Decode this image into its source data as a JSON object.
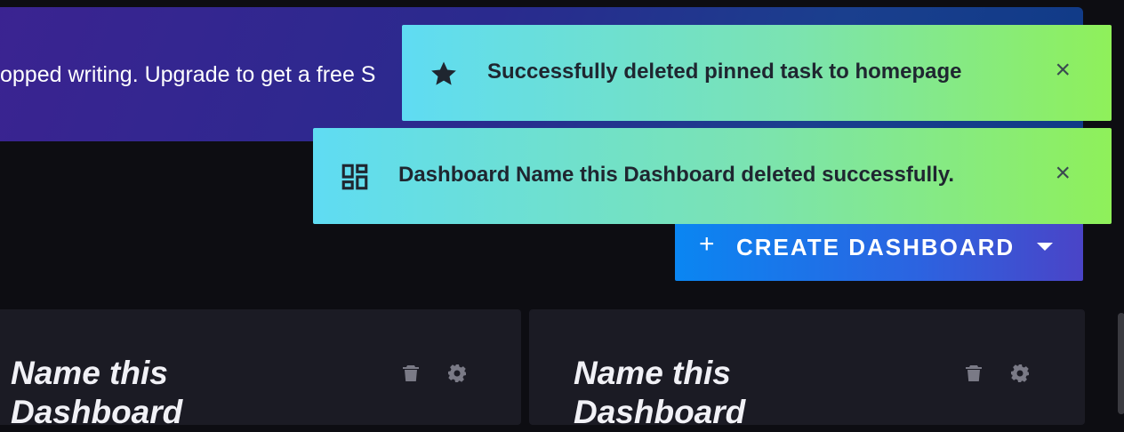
{
  "banner": {
    "text": "opped writing. Upgrade to get a free S"
  },
  "notifications": [
    {
      "icon": "star-icon",
      "message": "Successfully deleted pinned task to homepage",
      "close": "×"
    },
    {
      "icon": "dashboard-icon",
      "message": "Dashboard Name this Dashboard deleted successfully.",
      "close": "×"
    }
  ],
  "create_button": {
    "plus": "+",
    "label": "CREATE DASHBOARD"
  },
  "dashboards": [
    {
      "title": "Name this Dashboard"
    },
    {
      "title": "Name this Dashboard"
    }
  ],
  "colors": {
    "background": "#0d0d12",
    "card": "#1b1b24",
    "toast_start": "#5fdcf3",
    "toast_end": "#8ff05a",
    "button_start": "#0a86f2",
    "button_end": "#4a44c7"
  }
}
